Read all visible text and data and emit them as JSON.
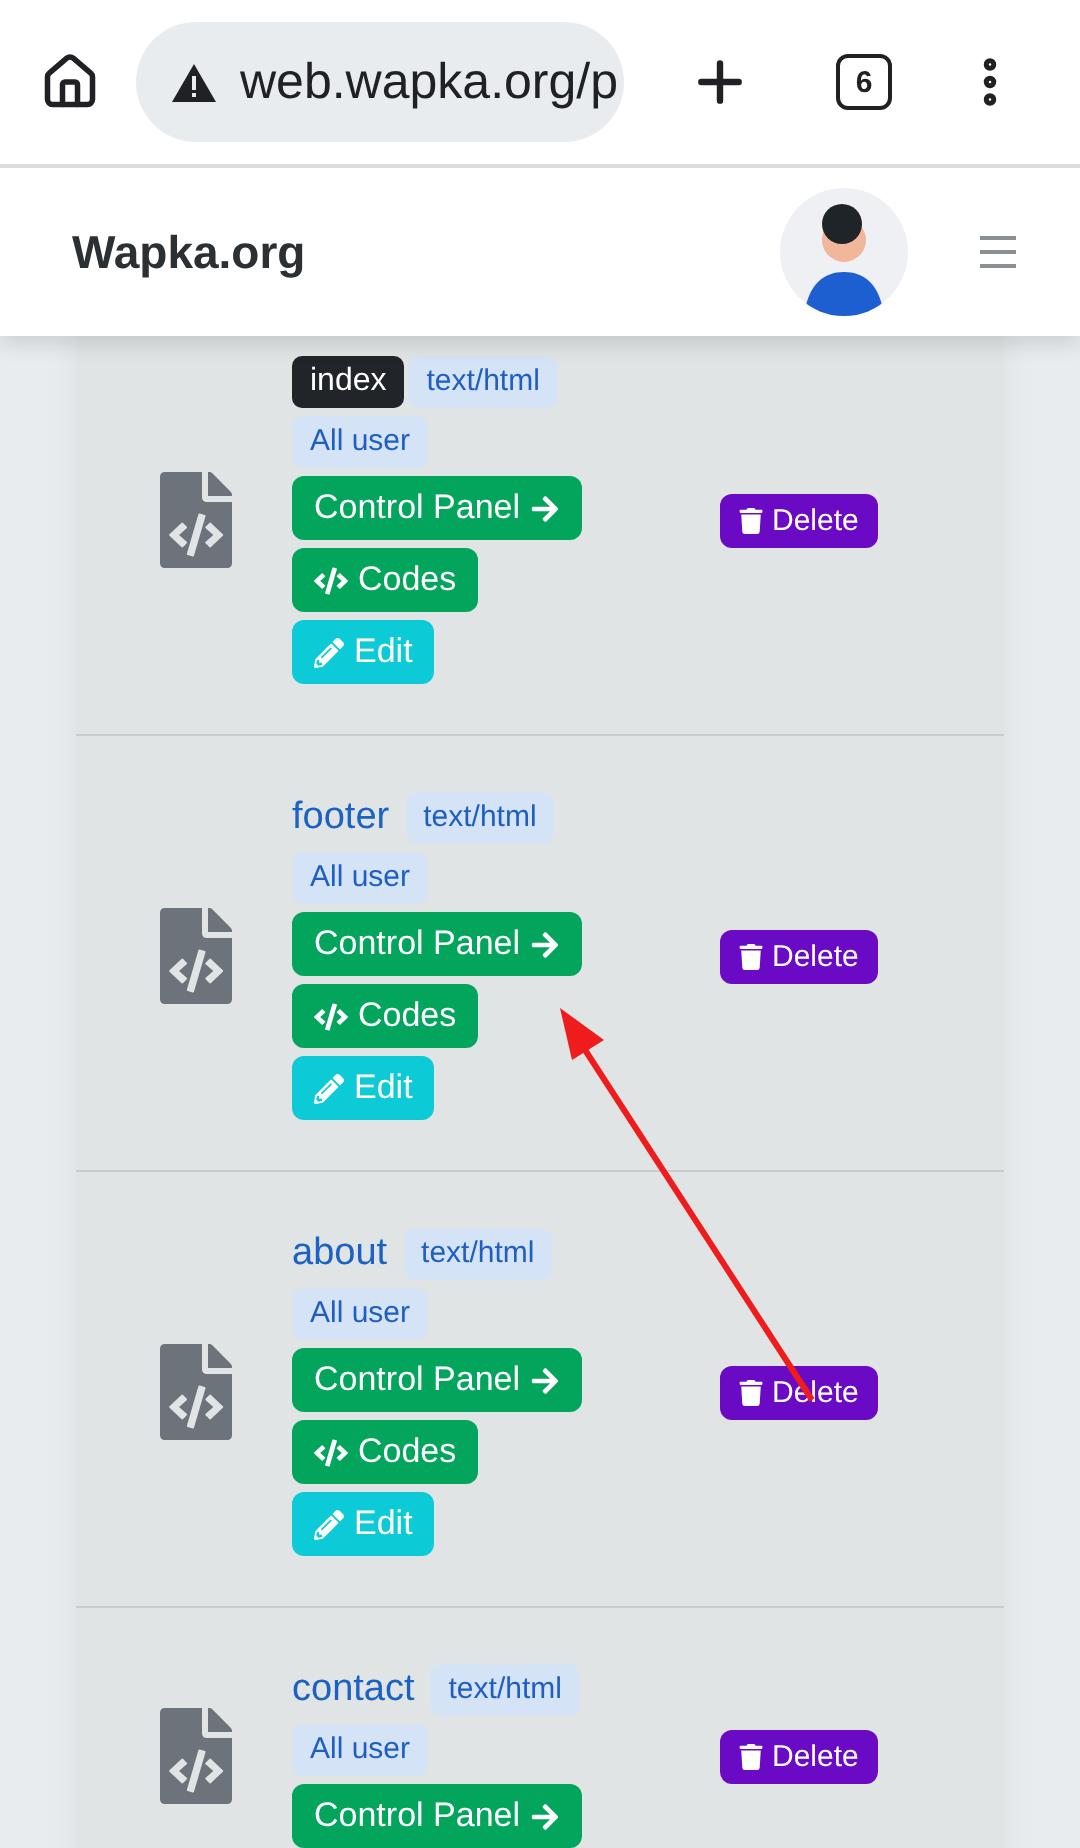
{
  "browser": {
    "url": "web.wapka.org/p",
    "tab_count": "6"
  },
  "site": {
    "brand": "Wapka.org"
  },
  "pages": [
    {
      "name": "index",
      "kind": "badge",
      "type": "text/html",
      "access": "All user",
      "actions": [
        {
          "kind": "panel",
          "label": "Control Panel"
        },
        {
          "kind": "codes",
          "label": "Codes"
        },
        {
          "kind": "edit",
          "label": "Edit"
        }
      ],
      "delete": "Delete"
    },
    {
      "name": "footer",
      "kind": "link",
      "type": "text/html",
      "access": "All user",
      "actions": [
        {
          "kind": "panel",
          "label": "Control Panel"
        },
        {
          "kind": "codes",
          "label": "Codes"
        },
        {
          "kind": "edit",
          "label": "Edit"
        }
      ],
      "delete": "Delete"
    },
    {
      "name": "about",
      "kind": "link",
      "type": "text/html",
      "access": "All user",
      "actions": [
        {
          "kind": "panel",
          "label": "Control Panel"
        },
        {
          "kind": "codes",
          "label": "Codes"
        },
        {
          "kind": "edit",
          "label": "Edit"
        }
      ],
      "delete": "Delete"
    },
    {
      "name": "contact",
      "kind": "link",
      "type": "text/html",
      "access": "All user",
      "actions": [
        {
          "kind": "panel",
          "label": "Control Panel"
        }
      ],
      "delete": "Delete"
    }
  ]
}
